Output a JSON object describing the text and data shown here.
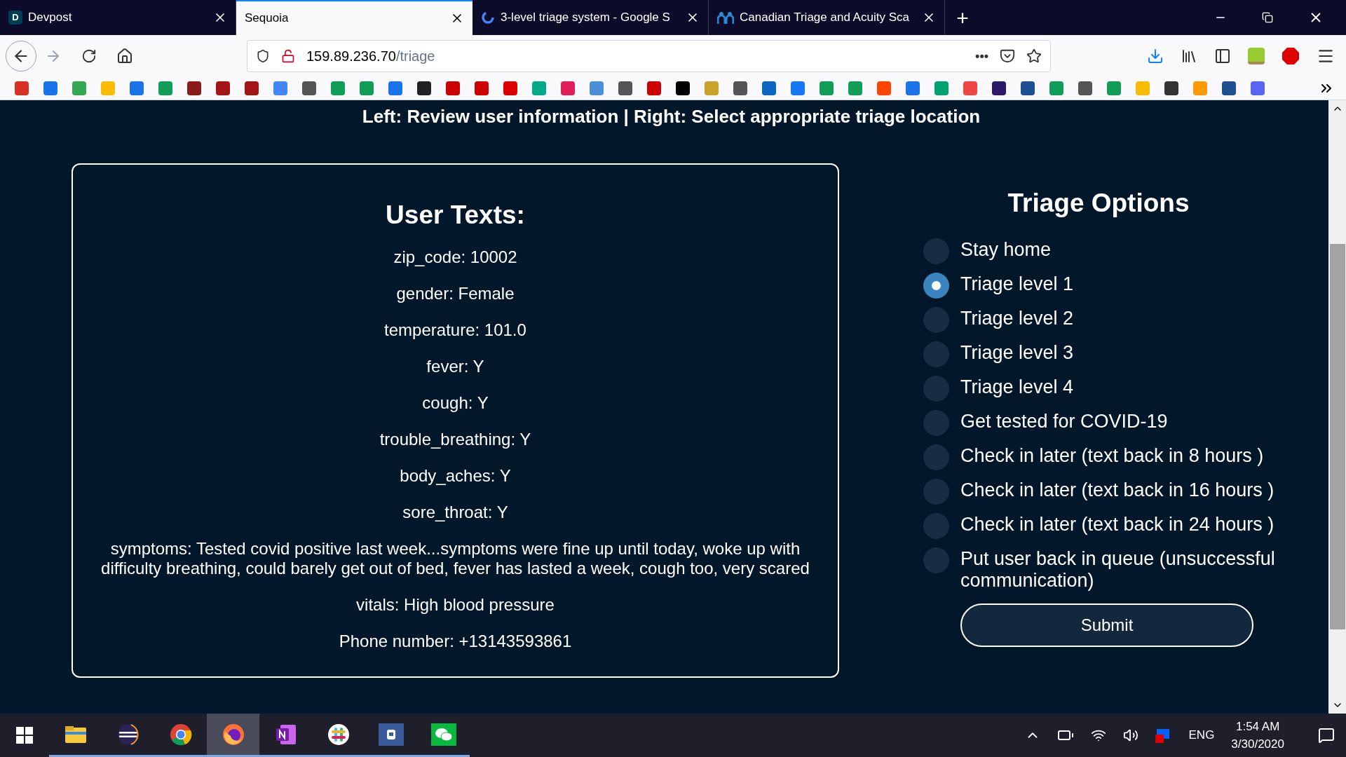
{
  "browser": {
    "tabs": [
      {
        "label": "Devpost",
        "selected": false,
        "kind": "letter",
        "letter": "D"
      },
      {
        "label": "Sequoia",
        "selected": true,
        "kind": "none"
      },
      {
        "label": "3-level triage system - Google S",
        "selected": false,
        "kind": "google"
      },
      {
        "label": "Canadian Triage and Acuity Sca",
        "selected": false,
        "kind": "people"
      }
    ],
    "new_tab": "+",
    "url_host": "159.89.236.70",
    "url_path": "/triage",
    "page_actions": "•••"
  },
  "page": {
    "heading": "Left: Review user information | Right: Select appropriate triage location",
    "user_card": {
      "title": "User Texts:",
      "lines": [
        "zip_code: 10002",
        "gender: Female",
        "temperature: 101.0",
        "fever: Y",
        "cough: Y",
        "trouble_breathing: Y",
        "body_aches: Y",
        "sore_throat: Y",
        "symptoms: Tested covid positive last week...symptoms were fine up until today, woke up with difficulty breathing, could barely get out of bed, fever has lasted a week, cough too, very scared",
        "vitals: High blood pressure",
        "Phone number: +13143593861"
      ]
    },
    "triage": {
      "title": "Triage Options",
      "options": [
        {
          "label": "Stay home",
          "selected": false
        },
        {
          "label": "Triage level 1",
          "selected": true
        },
        {
          "label": "Triage level 2",
          "selected": false
        },
        {
          "label": "Triage level 3",
          "selected": false
        },
        {
          "label": "Triage level 4",
          "selected": false
        },
        {
          "label": "Get tested for COVID-19",
          "selected": false
        },
        {
          "label": "Check in later (text back in 8 hours )",
          "selected": false
        },
        {
          "label": "Check in later (text back in 16 hours )",
          "selected": false
        },
        {
          "label": "Check in later (text back in 24 hours )",
          "selected": false
        },
        {
          "label": "Put user back in queue (unsuccessful communication)",
          "selected": false
        }
      ],
      "submit": "Submit"
    }
  },
  "taskbar": {
    "apps": [
      {
        "kind": "folder",
        "selected": false
      },
      {
        "kind": "eclipse",
        "selected": false
      },
      {
        "kind": "chrome",
        "selected": false
      },
      {
        "kind": "firefox",
        "selected": true
      },
      {
        "kind": "onenote",
        "selected": false
      },
      {
        "kind": "slack",
        "selected": false
      },
      {
        "kind": "app",
        "selected": false
      },
      {
        "kind": "wechat",
        "selected": false
      }
    ],
    "language": "ENG",
    "time": "1:54 AM",
    "date": "3/30/2020"
  }
}
